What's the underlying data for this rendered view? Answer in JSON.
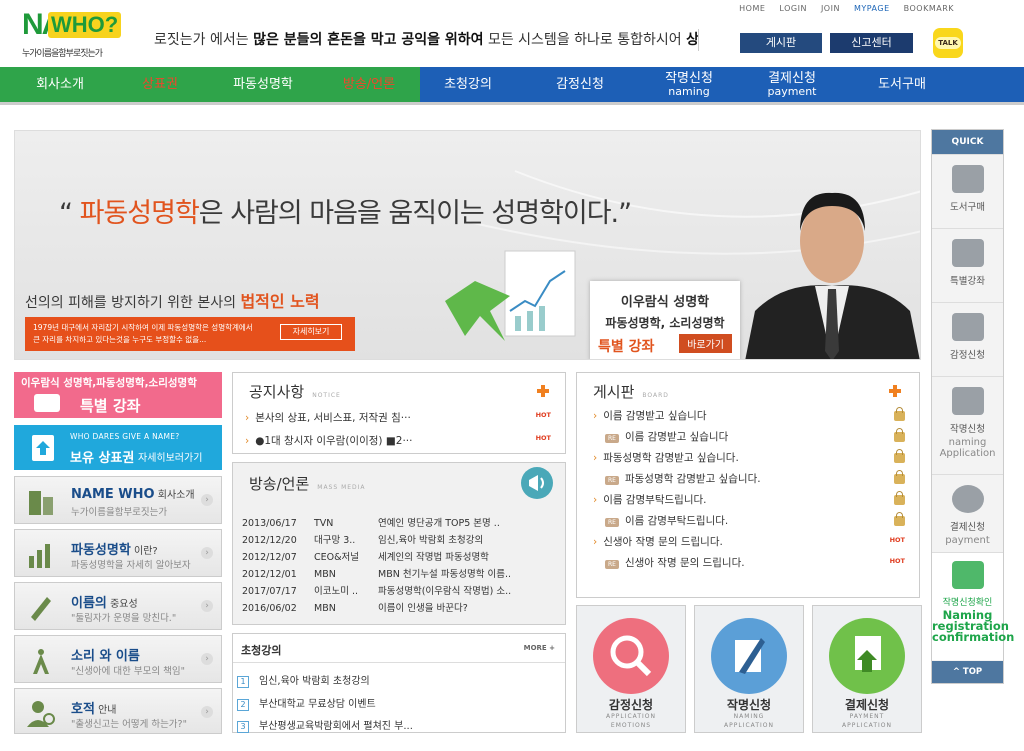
{
  "logo": {
    "word1": "NAME",
    "word2": "WHO?",
    "tagline": "누가이름을함부로짓는가"
  },
  "marquee": {
    "pre": "로짓는가 에서는 ",
    "b1": "많은 분들의 혼돈을 막고 공익을 위하여",
    "mid": " 모든 시스템을 하나로 통합하시어 ",
    "b2": "상표, 서비스표의 사용들"
  },
  "topnav": [
    "HOME",
    "LOGIN",
    "JOIN",
    "MYPAGE",
    "BOOKMARK"
  ],
  "header_buttons": {
    "board": "게시판",
    "report": "신고센터",
    "talk": "TALK"
  },
  "gnb": [
    {
      "label": "회사소개",
      "sub": ""
    },
    {
      "label": "상표권",
      "sub": ""
    },
    {
      "label": "파동성명학",
      "sub": ""
    },
    {
      "label": "방송/언론",
      "sub": ""
    },
    {
      "label": "초청강의",
      "sub": ""
    },
    {
      "label": "감정신청",
      "sub": ""
    },
    {
      "label": "작명신청",
      "sub": "naming"
    },
    {
      "label": "결제신청",
      "sub": "payment"
    },
    {
      "label": "도서구매",
      "sub": ""
    }
  ],
  "banner": {
    "q_open": "“ ",
    "q_em": "파동성명학",
    "q_rest": "은 사람의 마음을 움직이는 성명학이다.”",
    "sub_pre": "선의의 피해를 방지하기 위한 본사의 ",
    "sub_em": "법적인 노력",
    "box_l1": "1979년 대구에서 자리잡기 시작하여 이제 파동성명학은 성명학계에서",
    "box_l2": "큰 자리를 차지하고 있다는것을 누구도 부정할수 없을...",
    "box_btn": "자세히보기",
    "card_n1": "이우람식 성명학",
    "card_n2": "파동성명학, 소리성명학",
    "card_n3": "특별 강좌",
    "card_btn": "바로가기"
  },
  "left_menu": {
    "special_a": "이우람식 성명학,파동성명학,소리성명학",
    "special_b": "특별 강좌",
    "trade_a": "WHO DARES GIVE A NAME?",
    "trade_b": "보유 상표권",
    "trade_c": "자세히보러가기",
    "items": [
      {
        "t1": "NAME WHO",
        "small": " 회사소개",
        "t2": "누가이름을함부로짓는가"
      },
      {
        "t1": "파동성명학",
        "small": " 이란?",
        "t2": "파동성명학을 자세히 알아보자"
      },
      {
        "t1": "이름의",
        "small": " 중요성",
        "t2": "\"둘림자가 운명을 망친다.\""
      },
      {
        "t1": "소리 와 이름",
        "small": "",
        "t2": "\"신생아에 대한 부모의 책임\""
      },
      {
        "t1": "호적",
        "small": " 안내",
        "t2": "\"출생신고는 어떻게 하는가?\""
      }
    ]
  },
  "notice": {
    "title": "공지사항",
    "title_en": "NOTICE",
    "rows": [
      {
        "text": "본사의 상표, 서비스표, 저작권 침···",
        "hot": "HOT"
      },
      {
        "text": "●1대 창시자 이우람(이이정) ■2···",
        "hot": "HOT"
      }
    ]
  },
  "media": {
    "title": "방송/언론",
    "title_en": "MASS MEDIA",
    "rows": [
      {
        "date": "2013/06/17",
        "src": "TVN",
        "text": "연예인 명단공개 TOP5 본명 .."
      },
      {
        "date": "2012/12/20",
        "src": "대구망 3..",
        "text": "임신,육아 박람회 초청강의"
      },
      {
        "date": "2012/12/07",
        "src": "CEO&저널",
        "text": "세계인의 작명법 파동성명학"
      },
      {
        "date": "2012/12/01",
        "src": "MBN",
        "text": "MBN 천기누설 파동성명학 이름.."
      },
      {
        "date": "2017/07/17",
        "src": "이코노미 ..",
        "text": "파동성명학(이우람식 작명법) 소.."
      },
      {
        "date": "2016/06/02",
        "src": "MBN",
        "text": "이름이 인생을 바꾼다?"
      }
    ]
  },
  "lectures": {
    "title": "초청강의",
    "more": "MORE +",
    "rows": [
      {
        "no": "1",
        "text": "임신,육아 박람회 초청강의"
      },
      {
        "no": "2",
        "text": "부산대학교 무료상담 이벤트"
      },
      {
        "no": "3",
        "text": "부산평생교육박람회에서 펼쳐진 부..."
      }
    ]
  },
  "board": {
    "title": "게시판",
    "title_en": "BOARD",
    "rows": [
      {
        "text": "이름 감명받고 싶습니다",
        "reply": false,
        "mark": "lock"
      },
      {
        "text": "이름 감명받고 싶습니다",
        "reply": true,
        "mark": "lock"
      },
      {
        "text": "파동성명학 감명받고 싶습니다.",
        "reply": false,
        "mark": "lock"
      },
      {
        "text": "파동성명학 감명받고 싶습니다.",
        "reply": true,
        "mark": "lock"
      },
      {
        "text": "이름 감명부탁드립니다.",
        "reply": false,
        "mark": "lock"
      },
      {
        "text": "이름 감명부탁드립니다.",
        "reply": true,
        "mark": "lock"
      },
      {
        "text": "신생아 작명 문의 드립니다.",
        "reply": false,
        "mark": "HOT"
      },
      {
        "text": "신생아 작명 문의 드립니다.",
        "reply": true,
        "mark": "HOT"
      }
    ]
  },
  "circles": [
    {
      "label": "감정신청",
      "en1": "APPLICATION",
      "en2": "EMOTIONS",
      "color": "#ee6f7e"
    },
    {
      "label": "작명신청",
      "en1": "NAMING",
      "en2": "APPLICATION",
      "color": "#5b9fd7"
    },
    {
      "label": "결제신청",
      "en1": "PAYMENT",
      "en2": "APPLICATION",
      "color": "#70c14a"
    }
  ],
  "quick": {
    "head": "QUICK",
    "items": [
      {
        "label": "도서구매",
        "en": ""
      },
      {
        "label": "특별강좌",
        "en": ""
      },
      {
        "label": "감정신청",
        "en": ""
      },
      {
        "label": "작명신청",
        "en": "naming Application"
      },
      {
        "label": "결제신청",
        "en": "payment"
      }
    ],
    "naming_label": "작명신청확인",
    "naming_en": "Naming registration confirmation",
    "top": "^ TOP"
  }
}
